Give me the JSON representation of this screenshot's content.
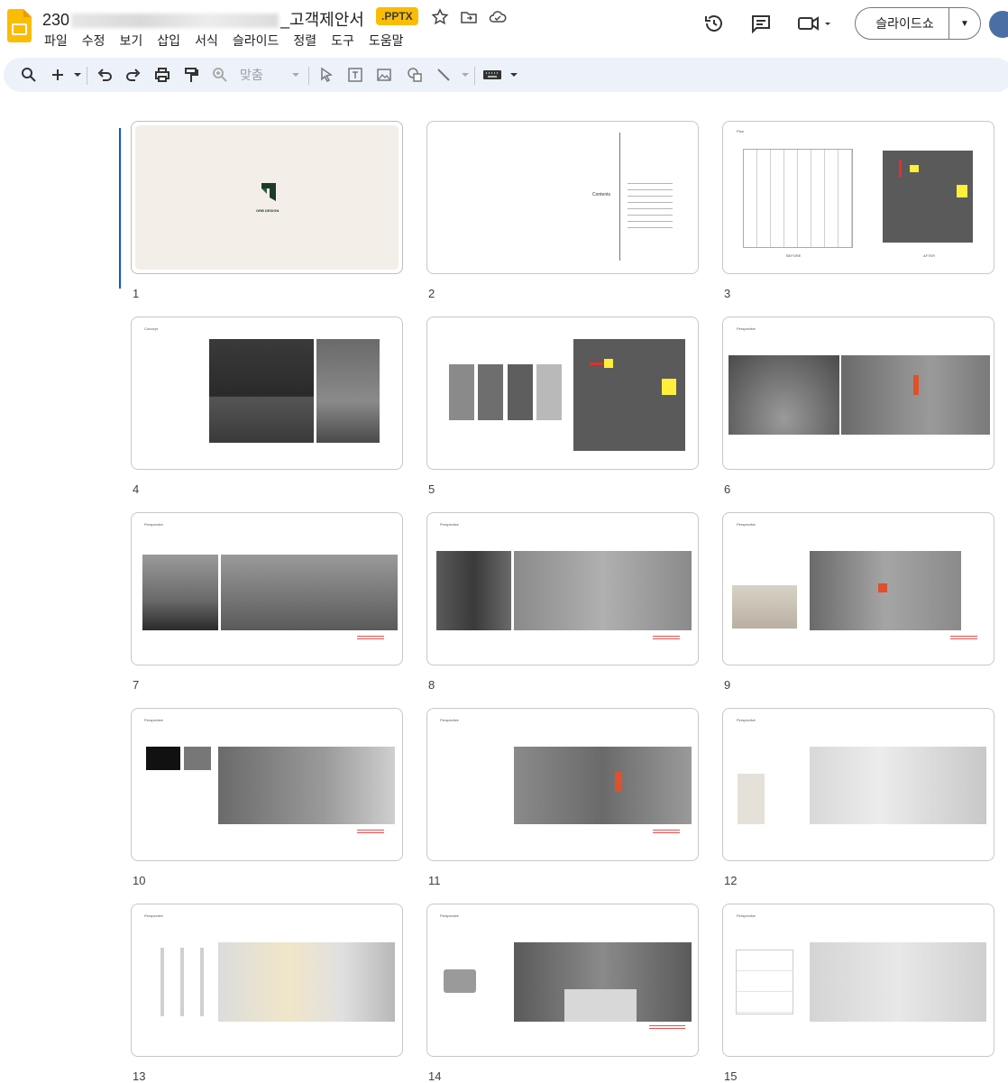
{
  "document": {
    "title_prefix": "230",
    "title_suffix": "_고객제안서",
    "file_badge": ".PPTX"
  },
  "menu": [
    "파일",
    "수정",
    "보기",
    "삽입",
    "서식",
    "슬라이드",
    "정렬",
    "도구",
    "도움말"
  ],
  "toolbar": {
    "zoom_label": "맞춤"
  },
  "slideshow": {
    "label": "슬라이드쇼"
  },
  "slides": [
    {
      "num": "1"
    },
    {
      "num": "2"
    },
    {
      "num": "3"
    },
    {
      "num": "4"
    },
    {
      "num": "5"
    },
    {
      "num": "6"
    },
    {
      "num": "7"
    },
    {
      "num": "8"
    },
    {
      "num": "9"
    },
    {
      "num": "10"
    },
    {
      "num": "11"
    },
    {
      "num": "12"
    },
    {
      "num": "13"
    },
    {
      "num": "14"
    },
    {
      "num": "15"
    }
  ],
  "slide_text": {
    "s1_brand": "ORB DESIGN",
    "s2_contents": "Contents",
    "s3_title": "Plan",
    "s3_before": "BEFORE",
    "s3_after": "AFTER",
    "s4_title": "Concept",
    "s6_title": "Perspective",
    "s7_title": "Perspective",
    "s8_title": "Perspective",
    "s9_title": "Perspective",
    "s10_title": "Perspective",
    "s11_title": "Perspective",
    "s12_title": "Perspective",
    "s13_title": "Perspective",
    "s14_title": "Perspective",
    "s15_title": "Perspective"
  },
  "colors": {
    "accent_blue": "#0b57d0",
    "badge": "#fbbc04",
    "toolbar_bg": "#edf2fa"
  }
}
